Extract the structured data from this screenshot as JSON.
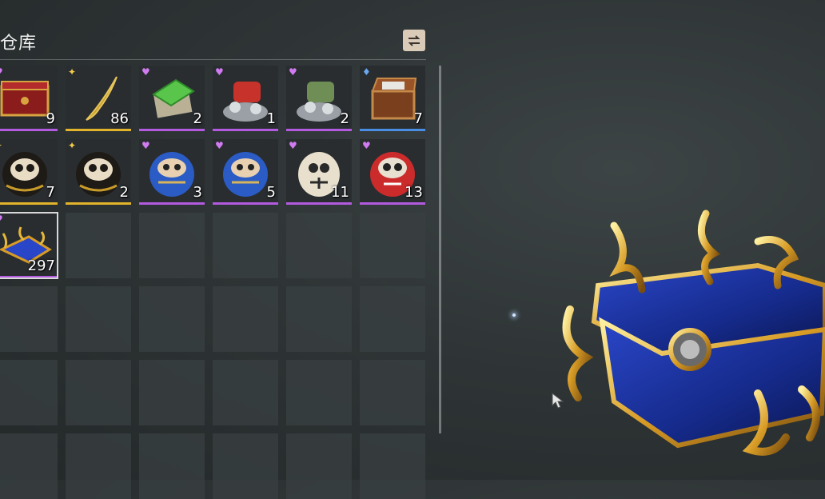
{
  "panel": {
    "title": "仓库"
  },
  "icons": {
    "sort": "sort-icon",
    "cursor": "mouse-cursor-icon"
  },
  "colors": {
    "purple": "#b25ae0",
    "gold": "#e2b42b",
    "blue": "#4a8ee3"
  },
  "slots": [
    {
      "item": "red-treasure-chest",
      "rarity": "purple",
      "count": "9"
    },
    {
      "item": "golden-feather",
      "rarity": "gold",
      "count": "86"
    },
    {
      "item": "green-stone-box",
      "rarity": "purple",
      "count": "2"
    },
    {
      "item": "red-coin-pile",
      "rarity": "purple",
      "count": "1"
    },
    {
      "item": "green-coin-pile",
      "rarity": "purple",
      "count": "2"
    },
    {
      "item": "brown-treasure-chest",
      "rarity": "blue",
      "count": "7"
    },
    {
      "item": "black-daruma",
      "rarity": "gold",
      "count": "7"
    },
    {
      "item": "black-daruma",
      "rarity": "gold",
      "count": "2"
    },
    {
      "item": "blue-daruma",
      "rarity": "purple",
      "count": "3"
    },
    {
      "item": "blue-daruma",
      "rarity": "purple",
      "count": "5"
    },
    {
      "item": "white-daruma",
      "rarity": "purple",
      "count": "11"
    },
    {
      "item": "red-daruma",
      "rarity": "purple",
      "count": "13"
    },
    {
      "item": "ornate-blue-chest",
      "rarity": "purple",
      "count": "297",
      "selected": true
    }
  ]
}
